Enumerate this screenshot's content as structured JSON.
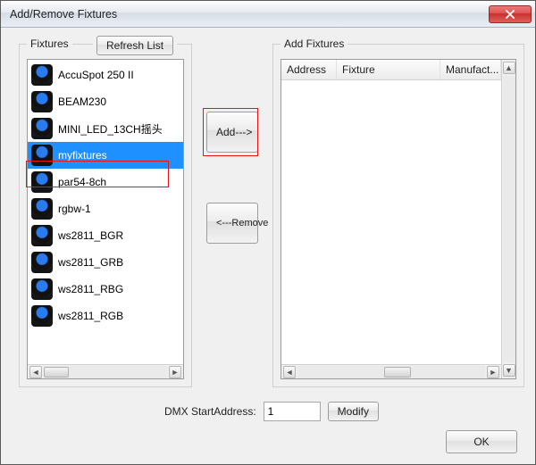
{
  "title": "Add/Remove Fixtures",
  "left": {
    "group_label": "Fixtures",
    "refresh_label": "Refresh List",
    "items": [
      "AccuSpot 250 II",
      "BEAM230",
      "MINI_LED_13CH摇头",
      "myfixtures",
      "par54-8ch",
      "rgbw-1",
      "ws2811_BGR",
      "ws2811_GRB",
      "ws2811_RBG",
      "ws2811_RGB"
    ],
    "selected_index": 3
  },
  "middle": {
    "add_label": "Add--->",
    "remove_label": "<---Remove"
  },
  "right": {
    "group_label": "Add Fixtures",
    "columns": {
      "address": "Address",
      "fixture": "Fixture",
      "manufacturer": "Manufact..."
    }
  },
  "footer": {
    "dmx_label": "DMX StartAddress:",
    "dmx_value": "1",
    "modify_label": "Modify",
    "ok_label": "OK"
  }
}
